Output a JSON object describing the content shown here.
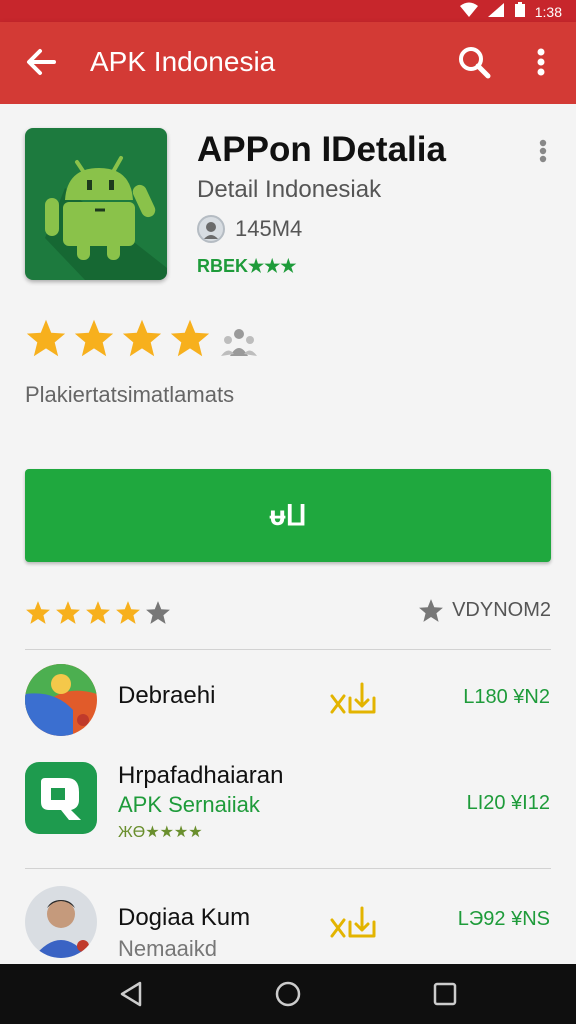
{
  "status_bar": {
    "time": "1:38"
  },
  "app_bar": {
    "title": "APK Indonesia"
  },
  "app": {
    "name": "APPon IDetalia",
    "subtitle": "Detail Indonesiak",
    "size": "145M4",
    "rating_text": "RBEK★★★",
    "description": "Plakiertatsimatlamats",
    "install_label": "ᵾⵡ"
  },
  "rating_summary": {
    "stars": 4,
    "count_label": "VDYNOM2"
  },
  "list": [
    {
      "name": "Debraehi",
      "sub": "",
      "price": "L180 ¥N2",
      "download_label": "x凵"
    },
    {
      "name": "Hrpafadhaiaran",
      "sub": "APK Sernaiiak",
      "stars_label": "ЖӨ★★★★",
      "price": "LI20 ¥I12"
    },
    {
      "name": "Dogiaa Kum",
      "sub": "Nemaaikd",
      "price": "LЭ92 ¥NS",
      "download_label": "x凵"
    }
  ],
  "colors": {
    "app_bar": "#d33a35",
    "install": "#1fa83e",
    "accent_green": "#1e9b3a",
    "star": "#f7b01d"
  }
}
